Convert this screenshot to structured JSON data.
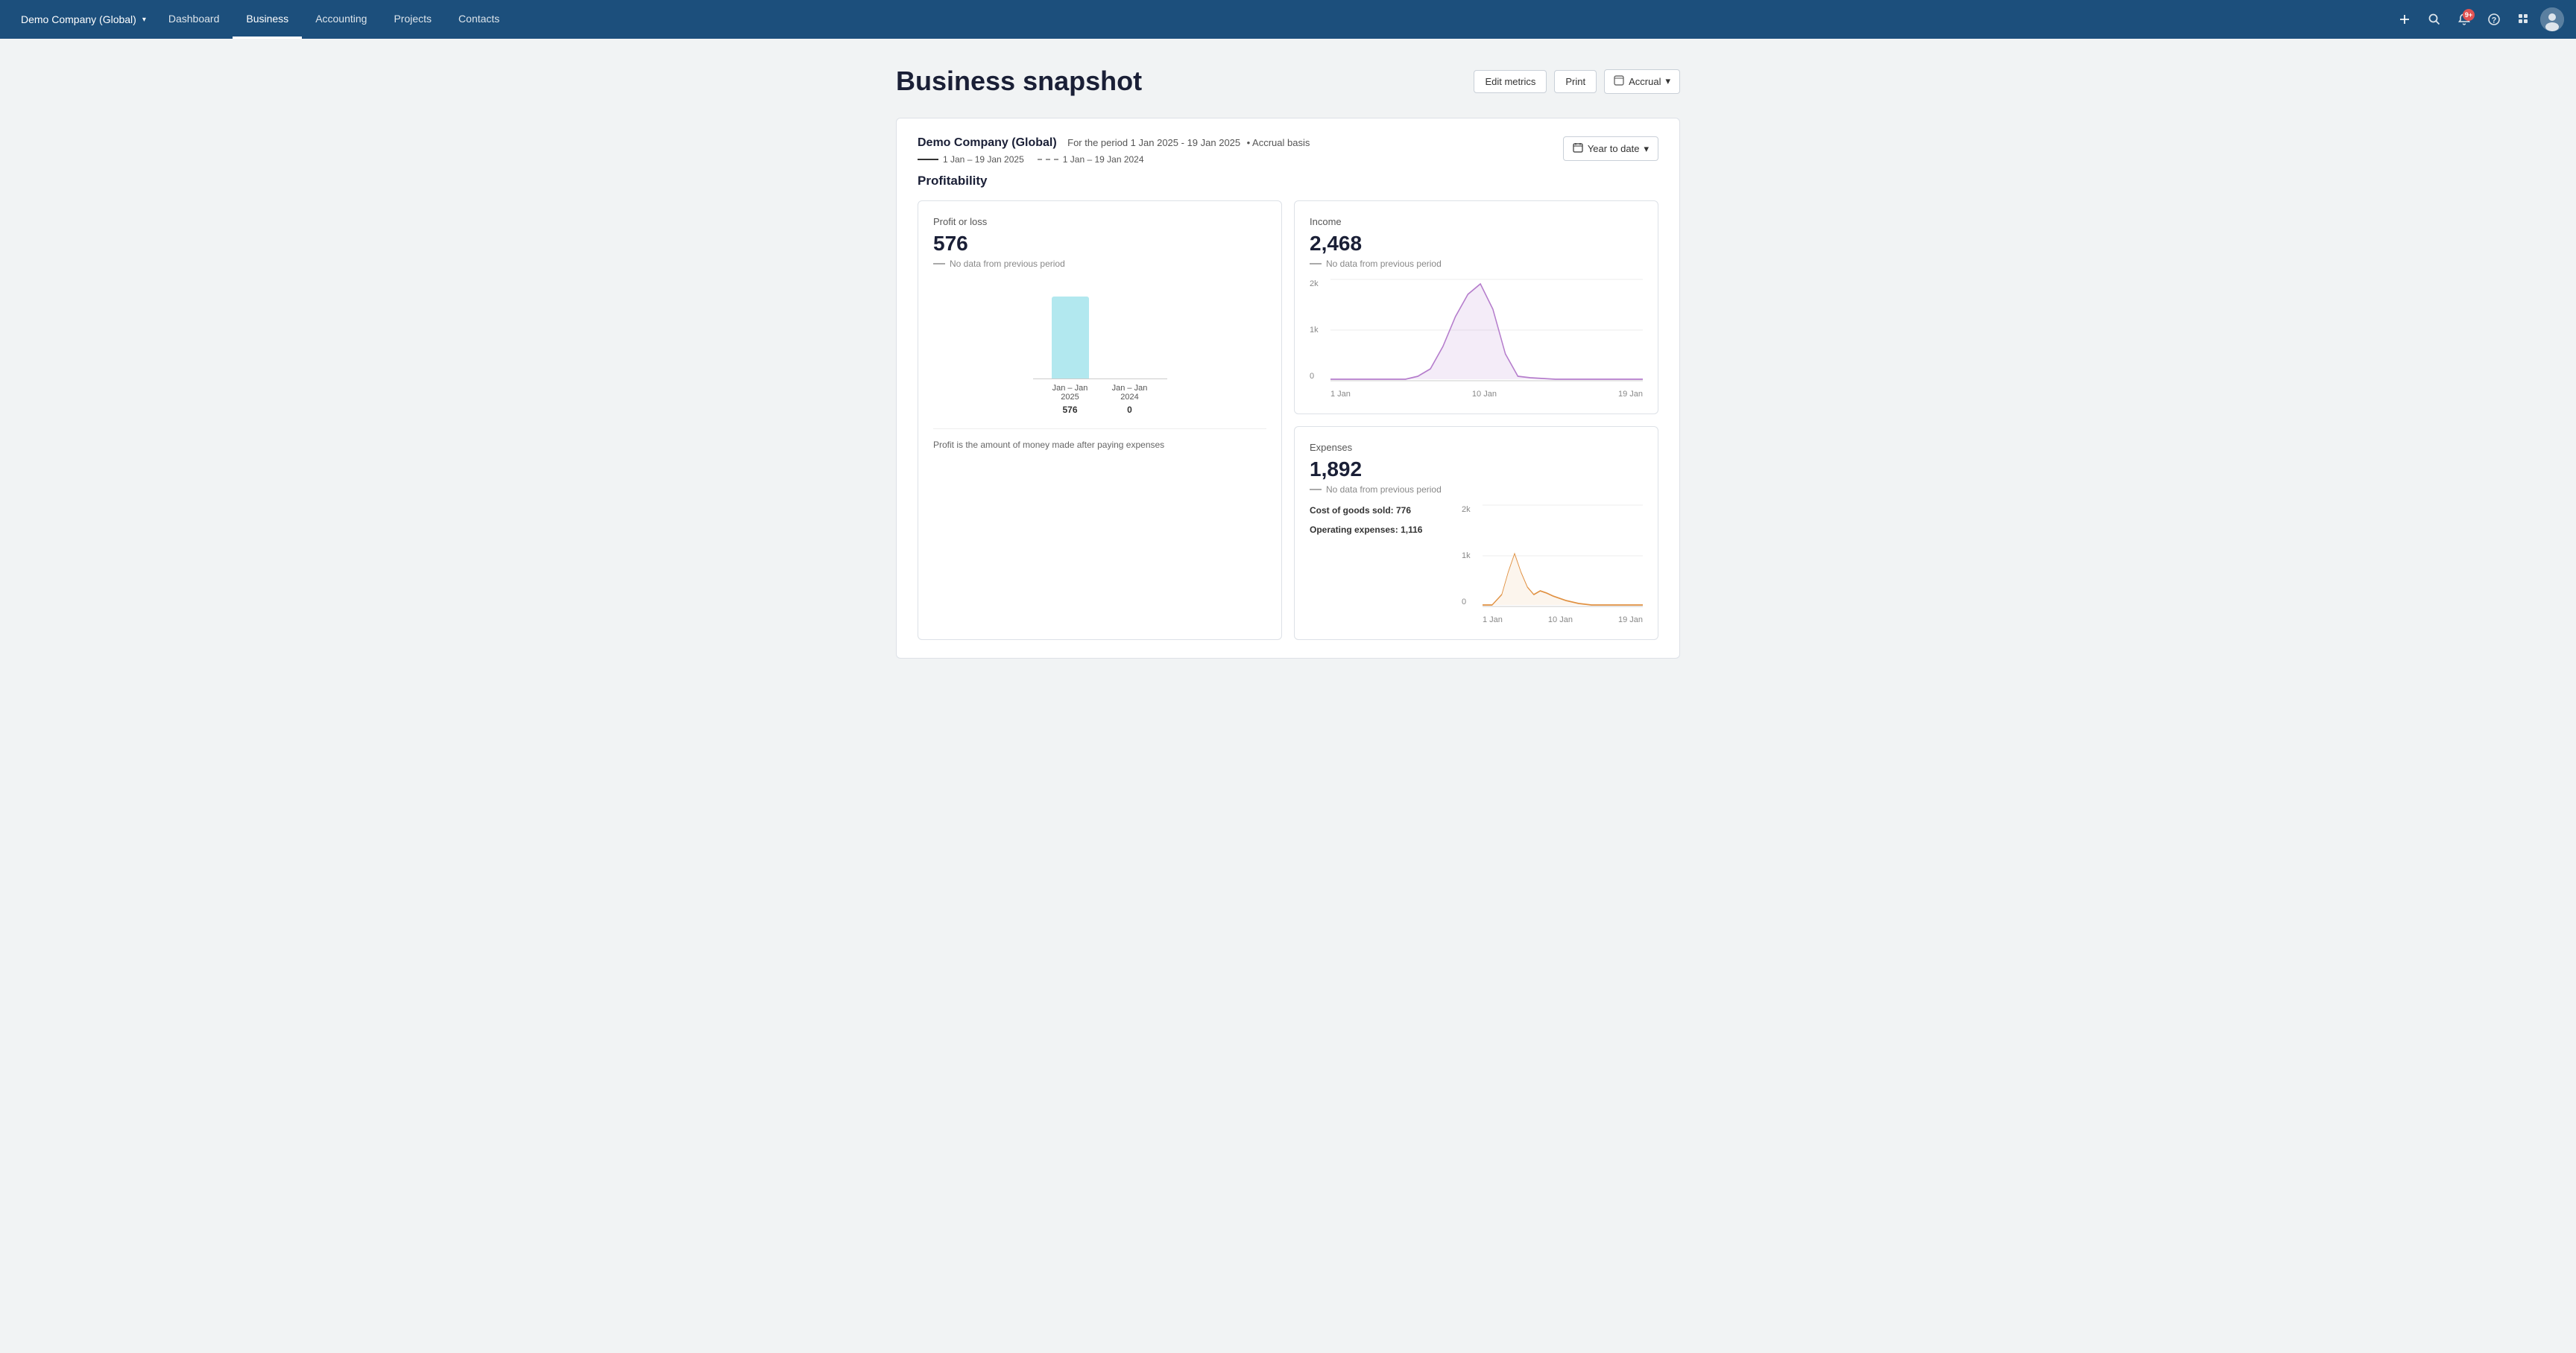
{
  "nav": {
    "company": "Demo Company (Global)",
    "links": [
      "Dashboard",
      "Business",
      "Accounting",
      "Projects",
      "Contacts"
    ],
    "active_link": "Business",
    "notification_count": "9+"
  },
  "page": {
    "title": "Business snapshot",
    "actions": {
      "edit_metrics": "Edit metrics",
      "print": "Print",
      "accrual": "Accrual"
    }
  },
  "snapshot": {
    "company": "Demo Company (Global)",
    "period_label": "For the period 1 Jan 2025 - 19 Jan 2025",
    "basis": "Accrual basis",
    "legend_current": "1 Jan – 19 Jan 2025",
    "legend_prev": "1 Jan – 19 Jan 2024",
    "ytd_label": "Year to date"
  },
  "profitability": {
    "section_title": "Profitability",
    "profit_or_loss": {
      "label": "Profit or loss",
      "value": "576",
      "prev_label": "No data from previous period",
      "bar_current_label": "Jan – Jan 2025",
      "bar_prev_label": "Jan – Jan 2024",
      "bar_current_val": "576",
      "bar_prev_val": "0",
      "note": "Profit is the amount of money made after paying expenses"
    },
    "income": {
      "label": "Income",
      "value": "2,468",
      "prev_label": "No data from previous period",
      "y_max": "2k",
      "y_mid": "1k",
      "y_min": "0",
      "x_start": "1 Jan",
      "x_mid": "10 Jan",
      "x_end": "19 Jan"
    },
    "expenses": {
      "label": "Expenses",
      "value": "1,892",
      "prev_label": "No data from previous period",
      "cost_of_goods": "776",
      "operating": "1,116",
      "cost_label": "Cost of goods sold:",
      "operating_label": "Operating expenses:",
      "y_max": "2k",
      "y_mid": "1k",
      "y_min": "0",
      "x_start": "1 Jan",
      "x_mid": "10 Jan",
      "x_end": "19 Jan"
    }
  }
}
